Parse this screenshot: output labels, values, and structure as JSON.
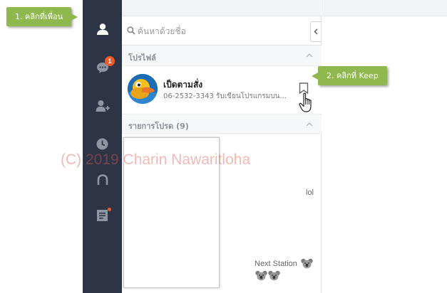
{
  "search": {
    "placeholder": "ค้นหาด้วยชื่อ"
  },
  "sidebar": {
    "chat_badge": "1"
  },
  "sections": {
    "profile_title": "โปรไฟล์",
    "favorites_title": "รายการโปรด (9)"
  },
  "profile": {
    "name": "เป็ดตามสั่ง",
    "status": "06-2532-3343 รับเขียนโปรแกรมบน..."
  },
  "chat_preview": {
    "line1": "lol",
    "line2": "Next Station"
  },
  "callouts": {
    "step1": "1. คลิกที่เพื่อน",
    "step2": "2. คลิกที่  Keep"
  },
  "watermark": "(C) 2019 Charin Nawaritloha",
  "colors": {
    "sidebar_bg": "#2d3446",
    "badge": "#f05a28",
    "callout_green": "#8fb84e"
  },
  "icons": [
    "friends-icon",
    "chat-icon",
    "add-friend-icon",
    "timeline-icon",
    "news-icon",
    "keep-notes-icon",
    "search-icon",
    "chevron-left-icon",
    "chevron-up-icon",
    "keep-icon",
    "hand-cursor-icon"
  ]
}
